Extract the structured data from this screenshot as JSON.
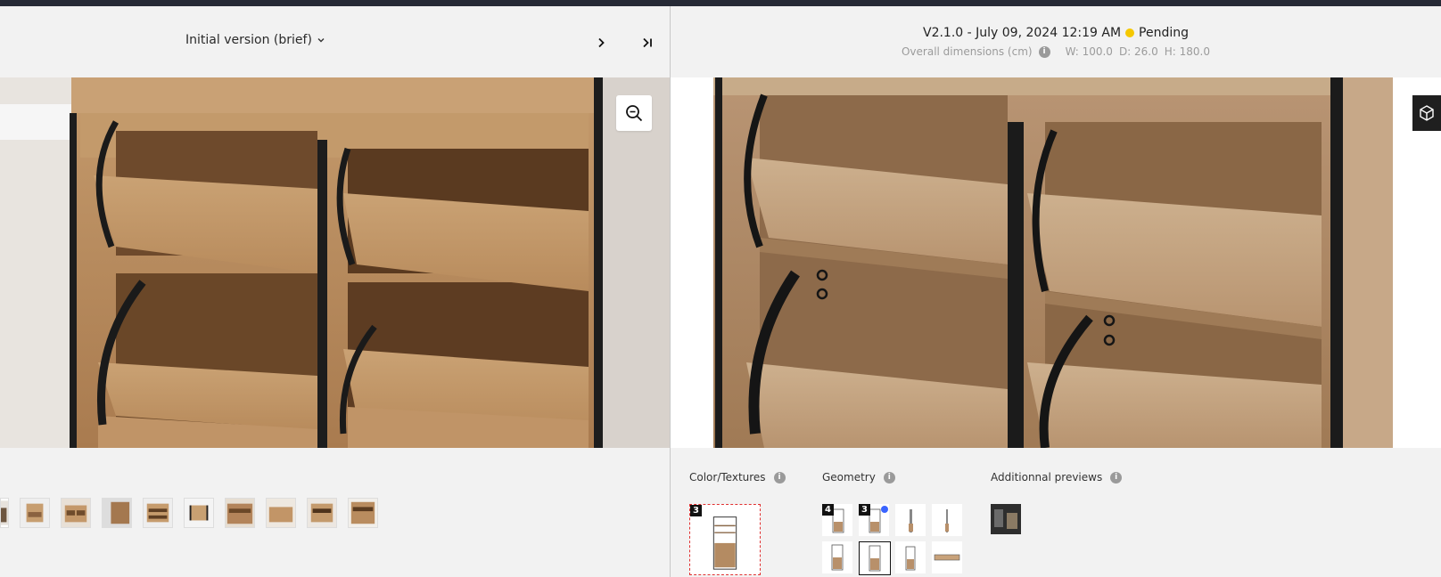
{
  "left_panel": {
    "version_dropdown": {
      "label": "Initial version (brief)",
      "icon": "chevron-down-icon"
    },
    "nav": {
      "next_icon": "chevron-right-icon",
      "last_icon": "skip-to-end-icon"
    },
    "zoom_icon": "zoom-out-icon",
    "thumbnail_count": 10
  },
  "right_panel": {
    "version_info": {
      "label": "V2.1.0 - July 09, 2024 12:19 AM",
      "status": "Pending",
      "status_color": "#f5c800"
    },
    "dimensions": {
      "label": "Overall dimensions (cm)",
      "w": "W: 100.0",
      "d": "D: 26.0",
      "h": "H: 180.0"
    },
    "viewer_icon": "3d-cube-icon",
    "sections": {
      "color_textures": {
        "title": "Color/Textures",
        "badge": "3"
      },
      "geometry": {
        "title": "Geometry",
        "badges": [
          "4",
          "3"
        ]
      },
      "additional_previews": {
        "title": "Additionnal previews"
      }
    }
  },
  "colors": {
    "topbar": "#262a36",
    "accent_dot": "#3a64ff",
    "selected_dashed": "#e03030"
  }
}
